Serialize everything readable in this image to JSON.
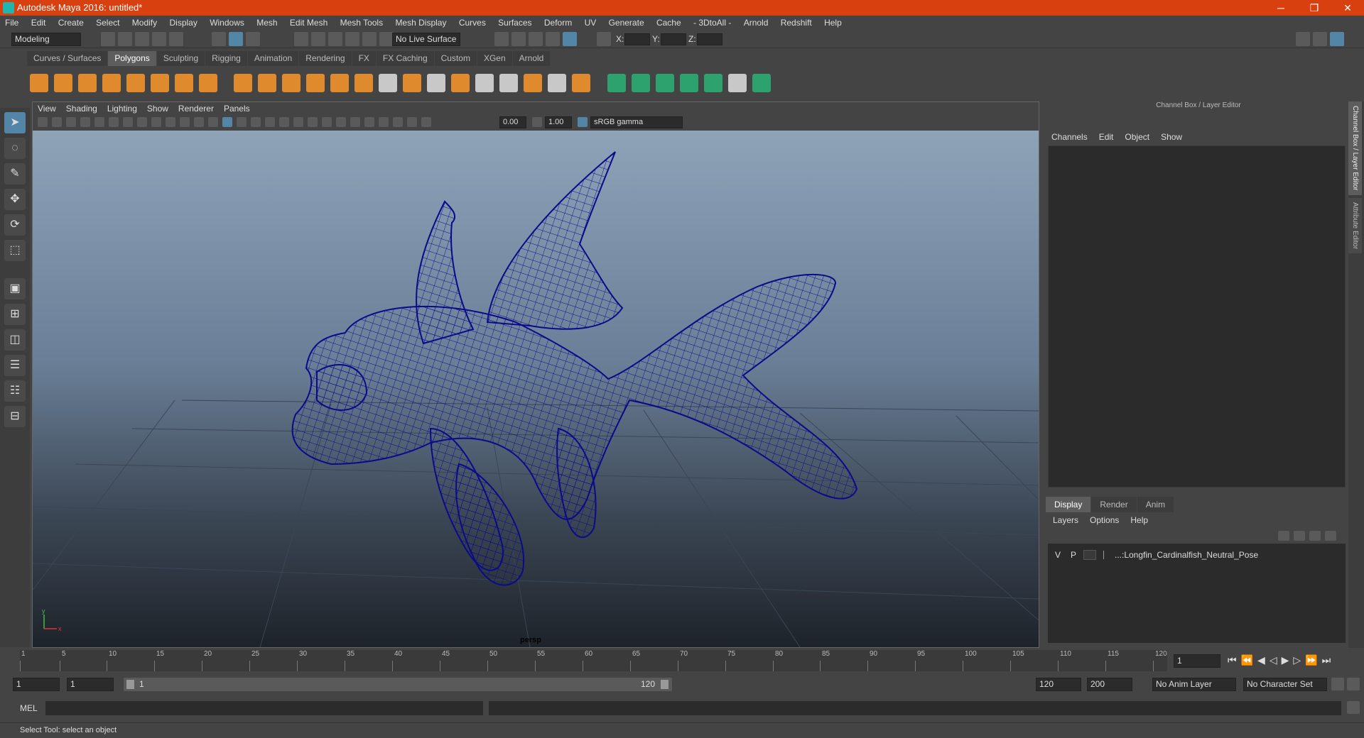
{
  "window": {
    "title": "Autodesk Maya 2016: untitled*",
    "minimize": "─",
    "maximize": "❐",
    "close": "✕"
  },
  "menubar": [
    "File",
    "Edit",
    "Create",
    "Select",
    "Modify",
    "Display",
    "Windows",
    "Mesh",
    "Edit Mesh",
    "Mesh Tools",
    "Mesh Display",
    "Curves",
    "Surfaces",
    "Deform",
    "UV",
    "Generate",
    "Cache",
    "- 3DtoAll -",
    "Arnold",
    "Redshift",
    "Help"
  ],
  "statusline": {
    "mode": "Modeling",
    "live_surface": "No Live Surface",
    "x_label": "X:",
    "y_label": "Y:",
    "z_label": "Z:"
  },
  "shelf_tabs": [
    "Curves / Surfaces",
    "Polygons",
    "Sculpting",
    "Rigging",
    "Animation",
    "Rendering",
    "FX",
    "FX Caching",
    "Custom",
    "XGen",
    "Arnold"
  ],
  "shelf_active": "Polygons",
  "viewport": {
    "menus": [
      "View",
      "Shading",
      "Lighting",
      "Show",
      "Renderer",
      "Panels"
    ],
    "exposure": "0.00",
    "gamma": "1.00",
    "color_space": "sRGB gamma",
    "camera": "persp",
    "axis_y": "y",
    "axis_x": "x"
  },
  "channel_box": {
    "header": "Channel Box / Layer Editor",
    "menus": [
      "Channels",
      "Edit",
      "Object",
      "Show"
    ]
  },
  "layer_editor": {
    "tabs": [
      "Display",
      "Render",
      "Anim"
    ],
    "active_tab": "Display",
    "menus": [
      "Layers",
      "Options",
      "Help"
    ],
    "layer": {
      "v": "V",
      "p": "P",
      "name": "...:Longfin_Cardinalfish_Neutral_Pose"
    }
  },
  "side_tabs": [
    "Channel Box / Layer Editor",
    "Attribute Editor"
  ],
  "timeline": {
    "ticks": [
      5,
      10,
      15,
      20,
      25,
      30,
      35,
      40,
      45,
      50,
      55,
      60,
      65,
      70,
      75,
      80,
      85,
      90,
      95,
      100,
      105,
      110,
      115,
      120
    ],
    "first": "1",
    "current_frame": "1"
  },
  "range": {
    "start": "1",
    "playback_start": "1",
    "slider_start": "1",
    "slider_end": "120",
    "playback_end": "120",
    "end": "200",
    "anim_layer": "No Anim Layer",
    "character_set": "No Character Set"
  },
  "command": {
    "label": "MEL"
  },
  "help_line": "Select Tool: select an object",
  "colors": {
    "titlebar": "#d9400f",
    "accent": "#5285a6",
    "wireframe": "#0a0a8a"
  }
}
